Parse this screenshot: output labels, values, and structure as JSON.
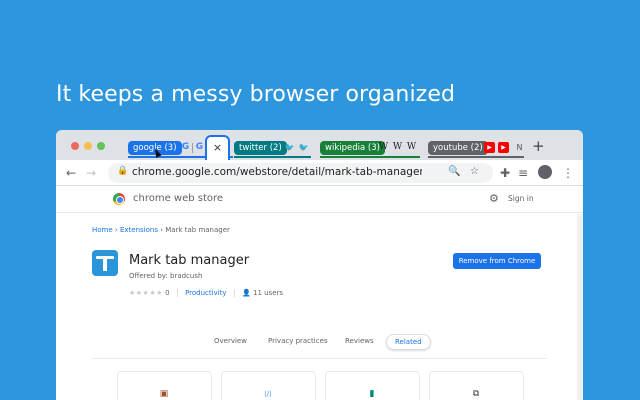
{
  "headline": "It keeps a messy browser organized",
  "tab_groups": [
    {
      "label": "google (3)",
      "color": "#1a73e8"
    },
    {
      "label": "twitter (2)",
      "color": "#007b83"
    },
    {
      "label": "wikipedia (3)",
      "color": "#188038"
    },
    {
      "label": "youtube (2)",
      "color": "#5f6368"
    }
  ],
  "active_tab_close": "×",
  "new_tab": "+",
  "address": {
    "url": "chrome.google.com/webstore/detail/mark-tab-manager/filgplhf..."
  },
  "store": {
    "title": "chrome web store",
    "signin": "Sign in"
  },
  "breadcrumb": {
    "home": "Home",
    "sep1": "›",
    "extensions": "Extensions",
    "sep2": "›",
    "current": "Mark tab manager"
  },
  "extension": {
    "name": "Mark tab manager",
    "offered_by": "Offered by: bradcush",
    "stars": "★★★★★",
    "rating_count": "0",
    "category": "Productivity",
    "users": "11 users",
    "remove_button": "Remove from Chrome"
  },
  "page_tabs": {
    "overview": "Overview",
    "privacy": "Privacy practices",
    "reviews": "Reviews",
    "related": "Related"
  },
  "icons": {
    "google_fav": "G",
    "twitter_fav": "🐦",
    "wiki_fav": "W",
    "youtube_fav": "▶"
  }
}
